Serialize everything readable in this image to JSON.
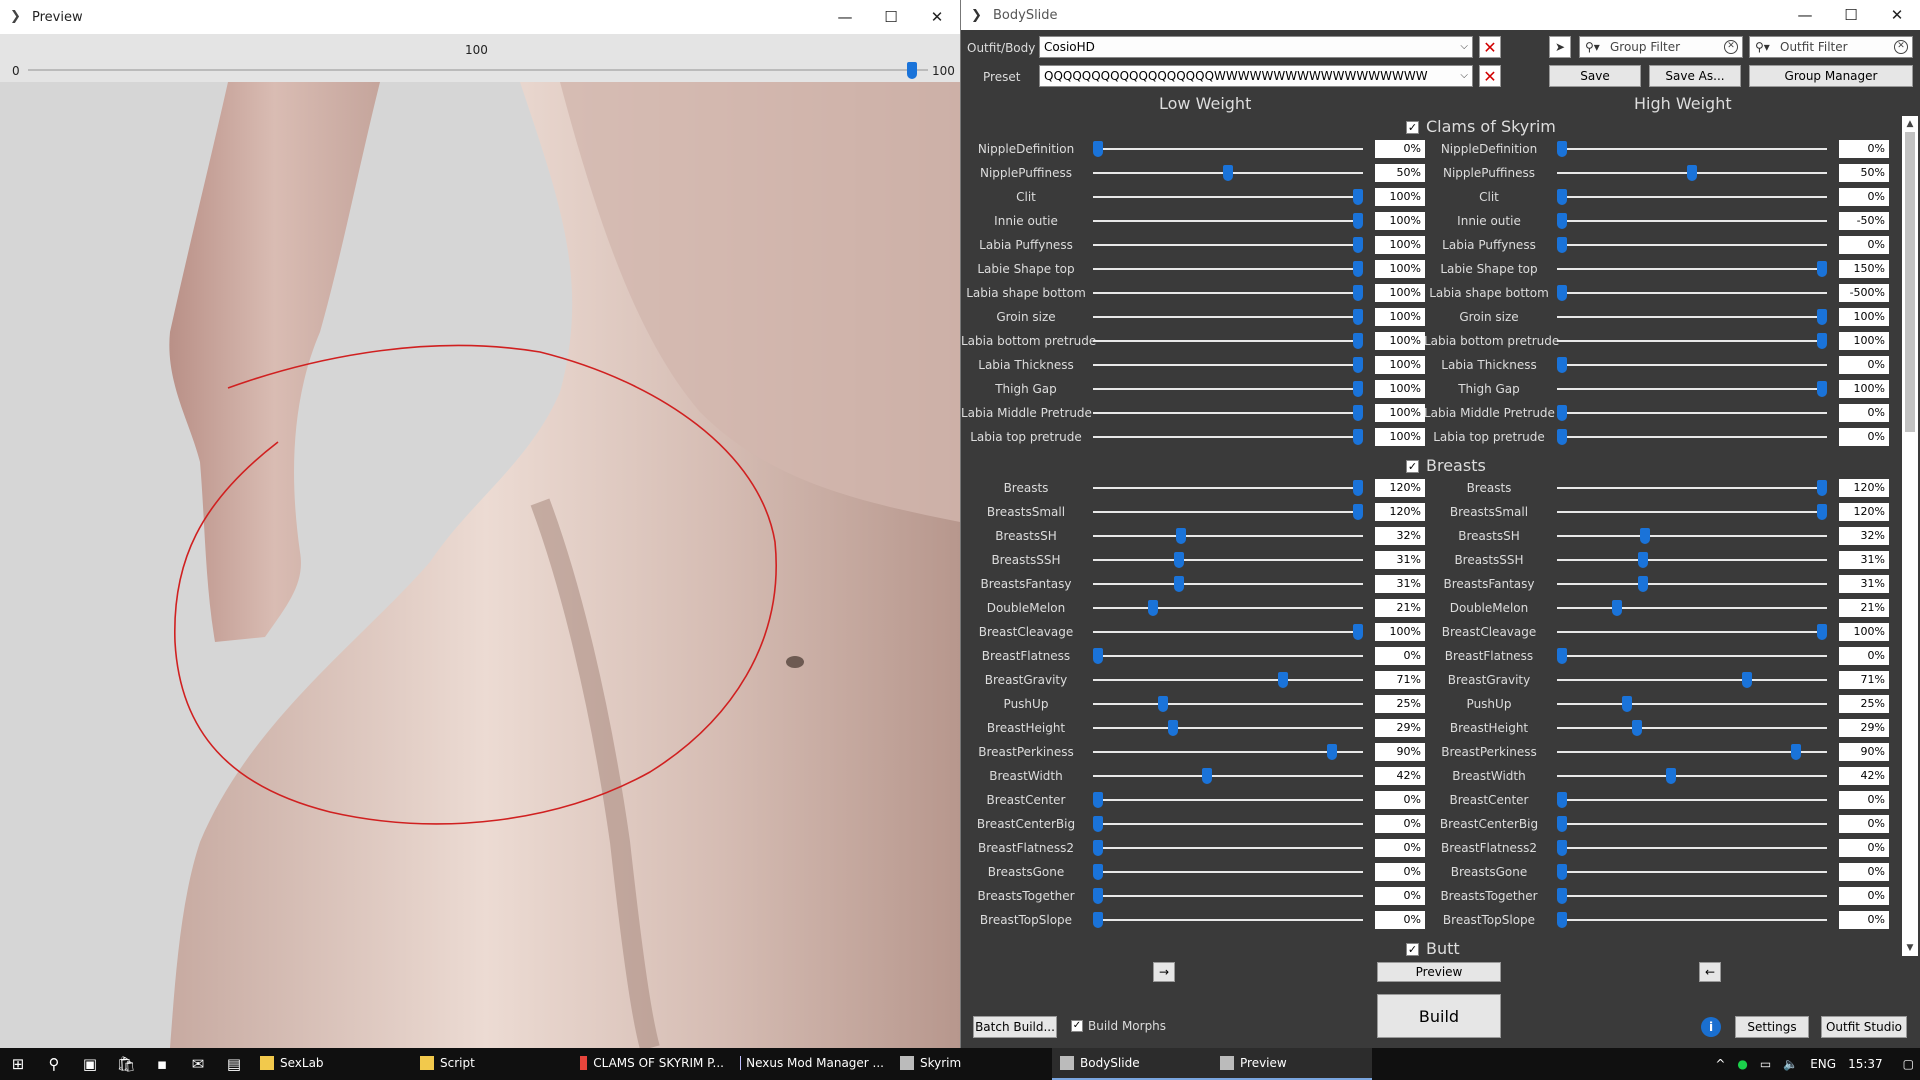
{
  "preview": {
    "title": "Preview",
    "slider_min": "0",
    "slider_value": "100",
    "slider_max": "100",
    "slider_level": 1.0
  },
  "bodyslide": {
    "title": "BodySlide",
    "outfit_label": "Outfit/Body",
    "outfit_value": "CosioHD",
    "preset_label": "Preset",
    "preset_value": "QQQQQQQQQQQQQQQQQQWWWWWWWWWWWWWWWWWW",
    "save": "Save",
    "save_as": "Save As...",
    "group_manager": "Group Manager",
    "group_filter": "Group Filter",
    "outfit_filter": "Outfit Filter",
    "low_weight": "Low Weight",
    "high_weight": "High Weight",
    "preview_button": "Preview",
    "build": "Build",
    "batch_build": "Batch Build...",
    "build_morphs": "Build Morphs",
    "settings": "Settings",
    "outfit_studio": "Outfit Studio",
    "arrow_right": "→",
    "arrow_left": "←",
    "groups": [
      {
        "name": "Clams of Skyrim",
        "sliders": [
          {
            "low_name": "NippleDefinition",
            "low": "0%",
            "lowf": 0.0,
            "high_name": "NippleDefinition",
            "high": "0%",
            "highf": 0.0
          },
          {
            "low_name": "NipplePuffiness",
            "low": "50%",
            "lowf": 0.5,
            "high_name": "NipplePuffiness",
            "high": "50%",
            "highf": 0.5
          },
          {
            "low_name": "Clit",
            "low": "100%",
            "lowf": 1.0,
            "high_name": "Clit",
            "high": "0%",
            "highf": 0.0
          },
          {
            "low_name": "Innie outie",
            "low": "100%",
            "lowf": 1.0,
            "high_name": "Innie outie",
            "high": "-50%",
            "highf": 0.0
          },
          {
            "low_name": "Labia Puffyness",
            "low": "100%",
            "lowf": 1.0,
            "high_name": "Labia Puffyness",
            "high": "0%",
            "highf": 0.0
          },
          {
            "low_name": "Labie Shape top",
            "low": "100%",
            "lowf": 1.0,
            "high_name": "Labie Shape top",
            "high": "150%",
            "highf": 1.0
          },
          {
            "low_name": "Labia shape bottom",
            "low": "100%",
            "lowf": 1.0,
            "high_name": "Labia shape bottom",
            "high": "-500%",
            "highf": 0.0
          },
          {
            "low_name": "Groin size",
            "low": "100%",
            "lowf": 1.0,
            "high_name": "Groin size",
            "high": "100%",
            "highf": 1.0
          },
          {
            "low_name": "Labia bottom pretrude",
            "low": "100%",
            "lowf": 1.0,
            "high_name": "Labia bottom pretrude",
            "high": "100%",
            "highf": 1.0
          },
          {
            "low_name": "Labia Thickness",
            "low": "100%",
            "lowf": 1.0,
            "high_name": "Labia Thickness",
            "high": "0%",
            "highf": 0.0
          },
          {
            "low_name": "Thigh Gap",
            "low": "100%",
            "lowf": 1.0,
            "high_name": "Thigh Gap",
            "high": "100%",
            "highf": 1.0
          },
          {
            "low_name": "Labia Middle Pretrude",
            "low": "100%",
            "lowf": 1.0,
            "high_name": "Labia Middle Pretrude",
            "high": "0%",
            "highf": 0.0
          },
          {
            "low_name": "Labia top pretrude",
            "low": "100%",
            "lowf": 1.0,
            "high_name": "Labia top pretrude",
            "high": "0%",
            "highf": 0.0
          }
        ]
      },
      {
        "name": "Breasts",
        "sliders": [
          {
            "low_name": "Breasts",
            "low": "120%",
            "lowf": 1.0,
            "high_name": "Breasts",
            "high": "120%",
            "highf": 1.0
          },
          {
            "low_name": "BreastsSmall",
            "low": "120%",
            "lowf": 1.0,
            "high_name": "BreastsSmall",
            "high": "120%",
            "highf": 1.0
          },
          {
            "low_name": "BreastsSH",
            "low": "32%",
            "lowf": 0.32,
            "high_name": "BreastsSH",
            "high": "32%",
            "highf": 0.32
          },
          {
            "low_name": "BreastsSSH",
            "low": "31%",
            "lowf": 0.31,
            "high_name": "BreastsSSH",
            "high": "31%",
            "highf": 0.31
          },
          {
            "low_name": "BreastsFantasy",
            "low": "31%",
            "lowf": 0.31,
            "high_name": "BreastsFantasy",
            "high": "31%",
            "highf": 0.31
          },
          {
            "low_name": "DoubleMelon",
            "low": "21%",
            "lowf": 0.21,
            "high_name": "DoubleMelon",
            "high": "21%",
            "highf": 0.21
          },
          {
            "low_name": "BreastCleavage",
            "low": "100%",
            "lowf": 1.0,
            "high_name": "BreastCleavage",
            "high": "100%",
            "highf": 1.0
          },
          {
            "low_name": "BreastFlatness",
            "low": "0%",
            "lowf": 0.0,
            "high_name": "BreastFlatness",
            "high": "0%",
            "highf": 0.0
          },
          {
            "low_name": "BreastGravity",
            "low": "71%",
            "lowf": 0.71,
            "high_name": "BreastGravity",
            "high": "71%",
            "highf": 0.71
          },
          {
            "low_name": "PushUp",
            "low": "25%",
            "lowf": 0.25,
            "high_name": "PushUp",
            "high": "25%",
            "highf": 0.25
          },
          {
            "low_name": "BreastHeight",
            "low": "29%",
            "lowf": 0.29,
            "high_name": "BreastHeight",
            "high": "29%",
            "highf": 0.29
          },
          {
            "low_name": "BreastPerkiness",
            "low": "90%",
            "lowf": 0.9,
            "high_name": "BreastPerkiness",
            "high": "90%",
            "highf": 0.9
          },
          {
            "low_name": "BreastWidth",
            "low": "42%",
            "lowf": 0.42,
            "high_name": "BreastWidth",
            "high": "42%",
            "highf": 0.42
          },
          {
            "low_name": "BreastCenter",
            "low": "0%",
            "lowf": 0.0,
            "high_name": "BreastCenter",
            "high": "0%",
            "highf": 0.0
          },
          {
            "low_name": "BreastCenterBig",
            "low": "0%",
            "lowf": 0.0,
            "high_name": "BreastCenterBig",
            "high": "0%",
            "highf": 0.0
          },
          {
            "low_name": "BreastFlatness2",
            "low": "0%",
            "lowf": 0.0,
            "high_name": "BreastFlatness2",
            "high": "0%",
            "highf": 0.0
          },
          {
            "low_name": "BreastsGone",
            "low": "0%",
            "lowf": 0.0,
            "high_name": "BreastsGone",
            "high": "0%",
            "highf": 0.0
          },
          {
            "low_name": "BreastsTogether",
            "low": "0%",
            "lowf": 0.0,
            "high_name": "BreastsTogether",
            "high": "0%",
            "highf": 0.0
          },
          {
            "low_name": "BreastTopSlope",
            "low": "0%",
            "lowf": 0.0,
            "high_name": "BreastTopSlope",
            "high": "0%",
            "highf": 0.0
          }
        ]
      },
      {
        "name": "Butt",
        "sliders": []
      }
    ]
  },
  "taskbar": {
    "apps": [
      {
        "label": "SexLab",
        "icon": "folder-icon",
        "color": "#f2c94c"
      },
      {
        "label": "Script",
        "icon": "folder-icon",
        "color": "#f2c94c"
      },
      {
        "label": "CLAMS OF SKYRIM P...",
        "icon": "chrome-icon",
        "color": "#e8453c"
      },
      {
        "label": "Nexus Mod Manager ...",
        "icon": "nexus-icon",
        "color": "#c0c0ff"
      },
      {
        "label": "Skyrim",
        "icon": "skyrim-icon",
        "color": "#bbbbbb"
      },
      {
        "label": "BodySlide",
        "icon": "bodyslide-icon",
        "color": "#bbbbbb"
      },
      {
        "label": "Preview",
        "icon": "preview-icon",
        "color": "#bbbbbb"
      }
    ],
    "lang": "ENG",
    "time": "15:37"
  }
}
